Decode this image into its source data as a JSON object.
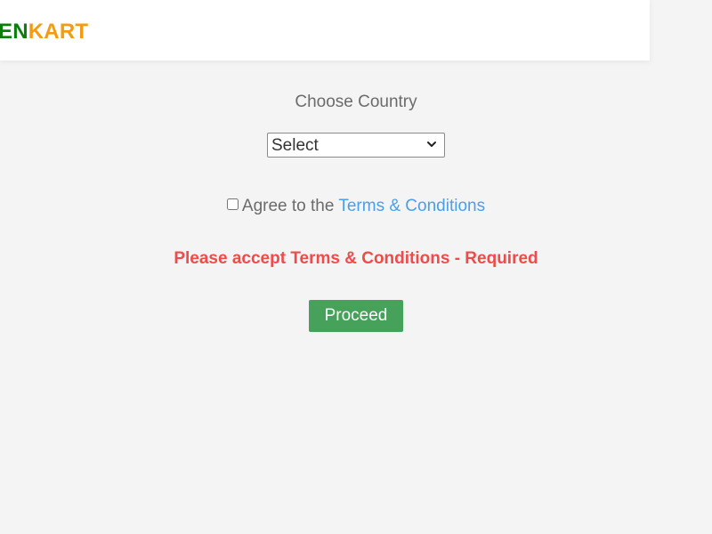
{
  "header": {
    "logo_part1": "EN",
    "logo_part2": "KART"
  },
  "form": {
    "country_label": "Choose Country",
    "country_select": {
      "selected": "Select",
      "options": [
        "Select"
      ]
    },
    "agree_text": "Agree to the ",
    "terms_link": "Terms & Conditions",
    "terms_checked": false,
    "error_message": "Please accept Terms & Conditions - Required",
    "proceed_label": "Proceed"
  },
  "colors": {
    "background": "#f4f4f4",
    "logo_green": "#0b7d0b",
    "logo_orange": "#f39c12",
    "link_blue": "#4a9fe8",
    "error_red": "#ee4b4b",
    "button_green": "#46a15a"
  },
  "icons": {
    "select_arrow": "chevron-down-icon"
  }
}
